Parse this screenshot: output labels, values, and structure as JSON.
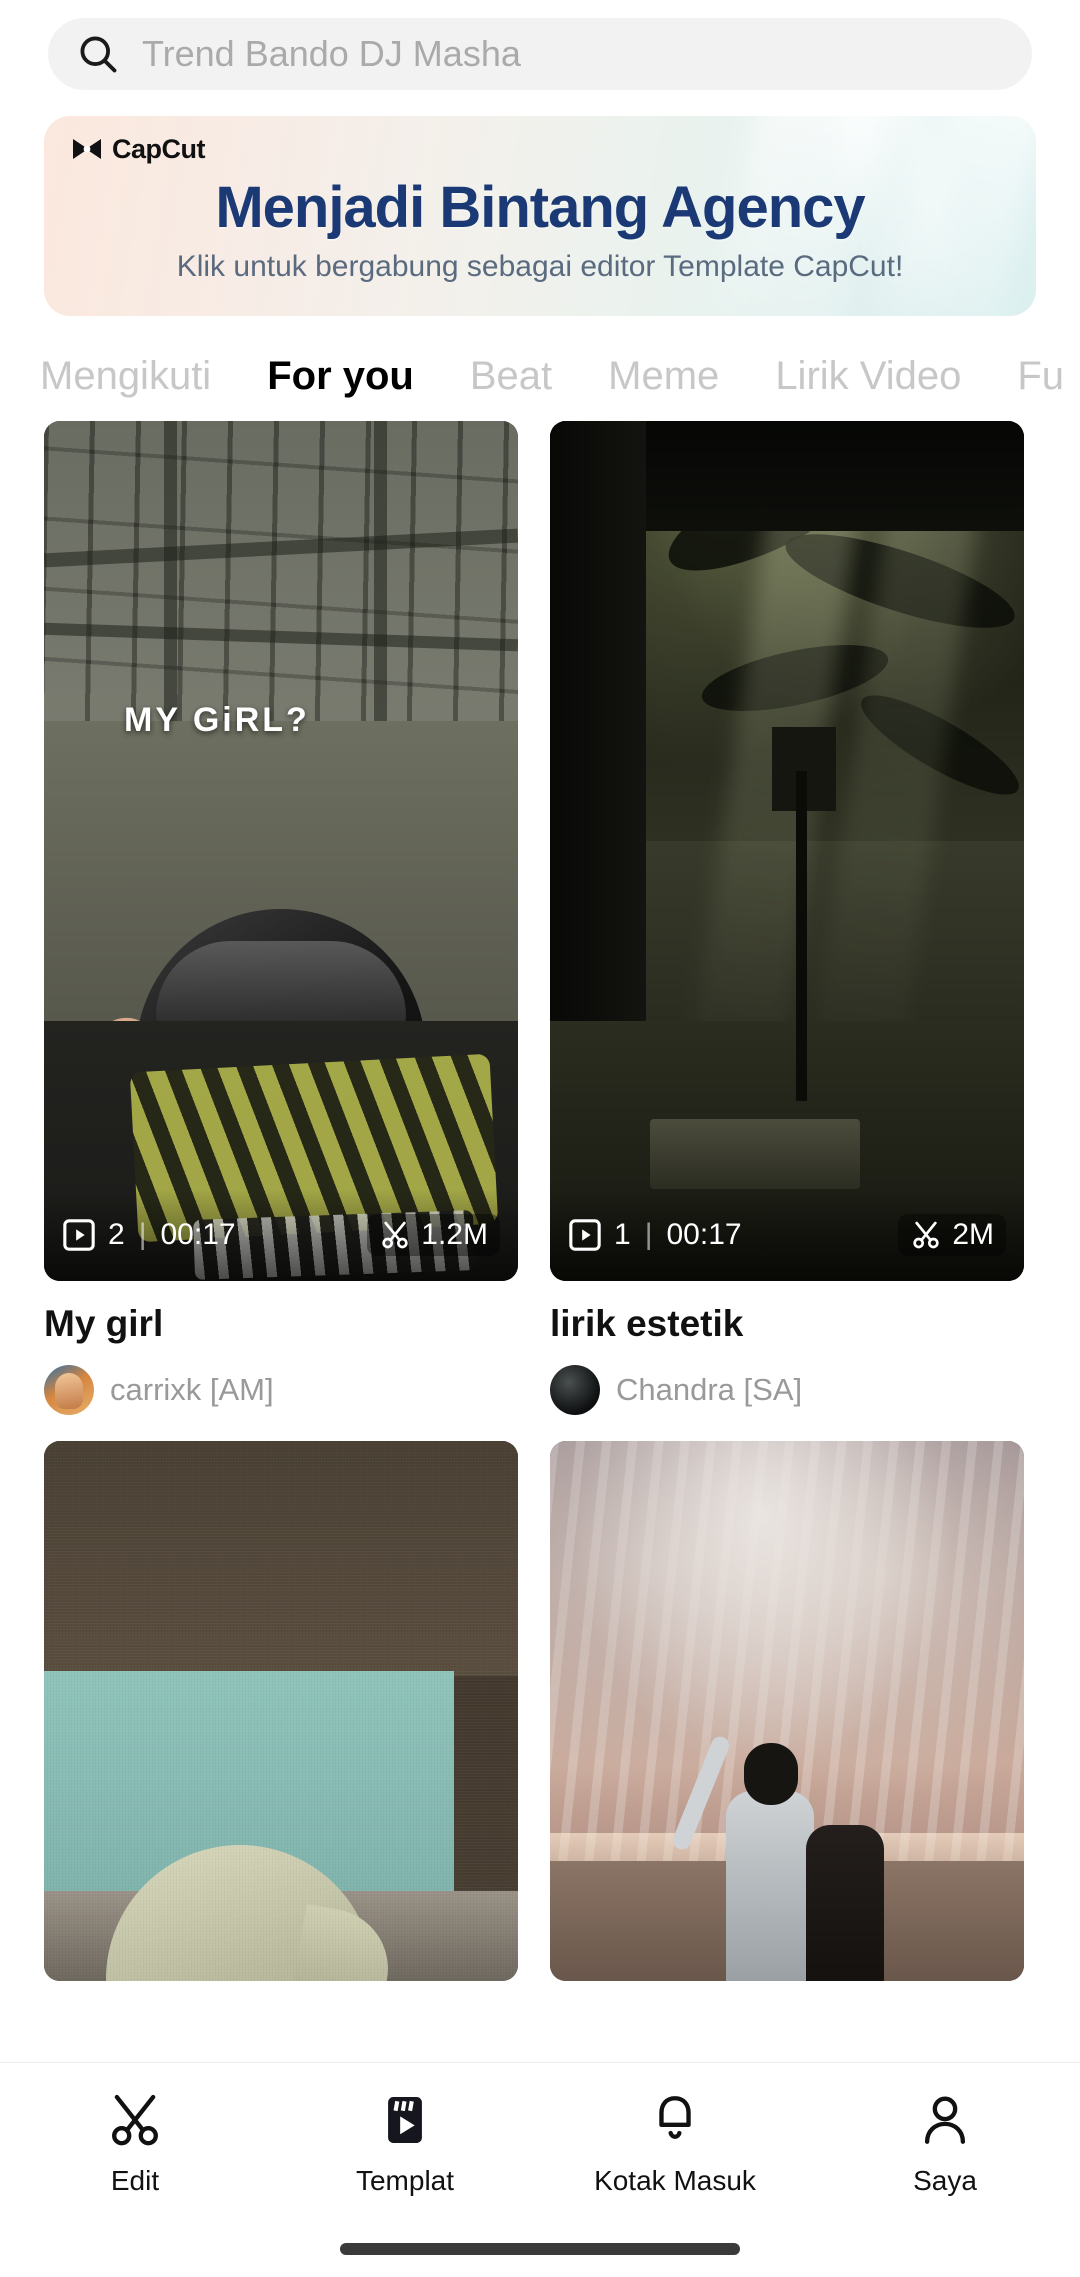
{
  "search": {
    "placeholder": "Trend Bando DJ Masha",
    "value": "",
    "icon": "search-icon"
  },
  "banner": {
    "brand": "CapCut",
    "brand_icon": "capcut-logo-icon",
    "title": "Menjadi Bintang Agency",
    "subtitle": "Klik untuk bergabung sebagai editor Template CapCut!",
    "title_color": "#1b3a75",
    "subtitle_color": "#5a6b80"
  },
  "tabs": [
    {
      "label": "Mengikuti",
      "active": false
    },
    {
      "label": "For you",
      "active": true
    },
    {
      "label": "Beat",
      "active": false
    },
    {
      "label": "Meme",
      "active": false
    },
    {
      "label": "Lirik Video",
      "active": false
    },
    {
      "label": "Fu",
      "active": false
    }
  ],
  "feed": {
    "row1": [
      {
        "title": "My girl",
        "author": "carrixk [AM]",
        "clips": "2",
        "separator": "|",
        "duration": "00:17",
        "uses": "1.2M",
        "uses_icon": "scissors-icon",
        "play_icon": "play-box-icon",
        "overlay_text": "MY GiRL?"
      },
      {
        "title": "lirik estetik",
        "author": "Chandra [SA]",
        "clips": "1",
        "separator": "|",
        "duration": "00:17",
        "uses": "2M",
        "uses_icon": "scissors-icon",
        "play_icon": "play-box-icon",
        "overlay_text": ""
      }
    ]
  },
  "bottom_nav": [
    {
      "label": "Edit",
      "icon": "scissors-icon",
      "active": false
    },
    {
      "label": "Templat",
      "icon": "template-card-icon",
      "active": true
    },
    {
      "label": "Kotak Masuk",
      "icon": "bell-icon",
      "active": false
    },
    {
      "label": "Saya",
      "icon": "person-icon",
      "active": false
    }
  ]
}
